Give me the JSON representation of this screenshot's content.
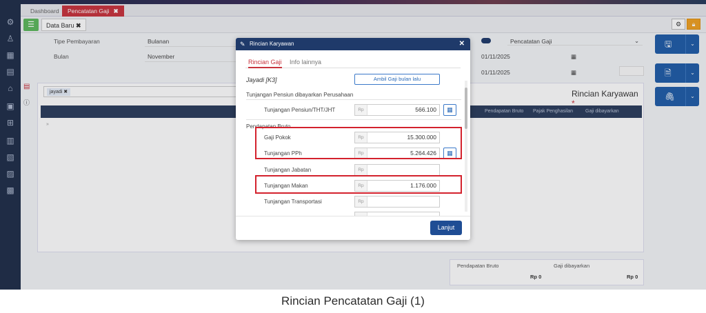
{
  "tabs": [
    {
      "label": "Dashboard",
      "active": false
    },
    {
      "label": "Pencatatan Gaji",
      "active": true
    }
  ],
  "toolbar": {
    "subtab_label": "Data Baru"
  },
  "form": {
    "tipe_label": "Tipe Pembayaran",
    "tipe_value": "Bulanan",
    "bulan_label": "Bulan",
    "bulan_value": "November",
    "toggle_label": "Pencatatan Gaji",
    "date1": "01/11/2025",
    "date2": "01/11/2025"
  },
  "list": {
    "search_chip": "jayadi",
    "title": "Rincian Karyawan",
    "columns": [
      "Pendapatan Bruto",
      "Pajak Penghasilan",
      "Gaji dibayarkan"
    ]
  },
  "summary": {
    "bruto_label": "Pendapatan Bruto",
    "bruto_value": "Rp 0",
    "gaji_label": "Gaji dibayarkan",
    "gaji_value": "Rp 0"
  },
  "modal": {
    "title": "Rincian Karyawan",
    "tab_active": "Rincian Gaji",
    "tab_other": "Info lainnya",
    "employee": "Jayadi [K3]",
    "ambil_button": "Ambil Gaji bulan lalu",
    "section_pensiun": "Tunjangan Pensiun dibayarkan Perusahaan",
    "section_bruto": "Pendapatan Bruto",
    "currency": "Rp",
    "rows": [
      {
        "label": "Tunjangan Pensiun/THT/JHT",
        "value": "566.100"
      },
      {
        "label": "Gaji Pokok",
        "value": "15.300.000"
      },
      {
        "label": "Tunjangan PPh",
        "value": "5.264.426"
      },
      {
        "label": "Tunjangan Jabatan",
        "value": ""
      },
      {
        "label": "Tunjangan Makan",
        "value": "1.176.000"
      },
      {
        "label": "Tunjangan Transportasi",
        "value": ""
      }
    ],
    "lanjut_button": "Lanjut"
  },
  "caption": "Rincian Pencatatan Gaji (1)",
  "icons": {
    "pencil": "pencil-icon",
    "close": "close-icon",
    "calculator": "calculator-icon",
    "search": "search-icon",
    "save": "save-icon"
  }
}
